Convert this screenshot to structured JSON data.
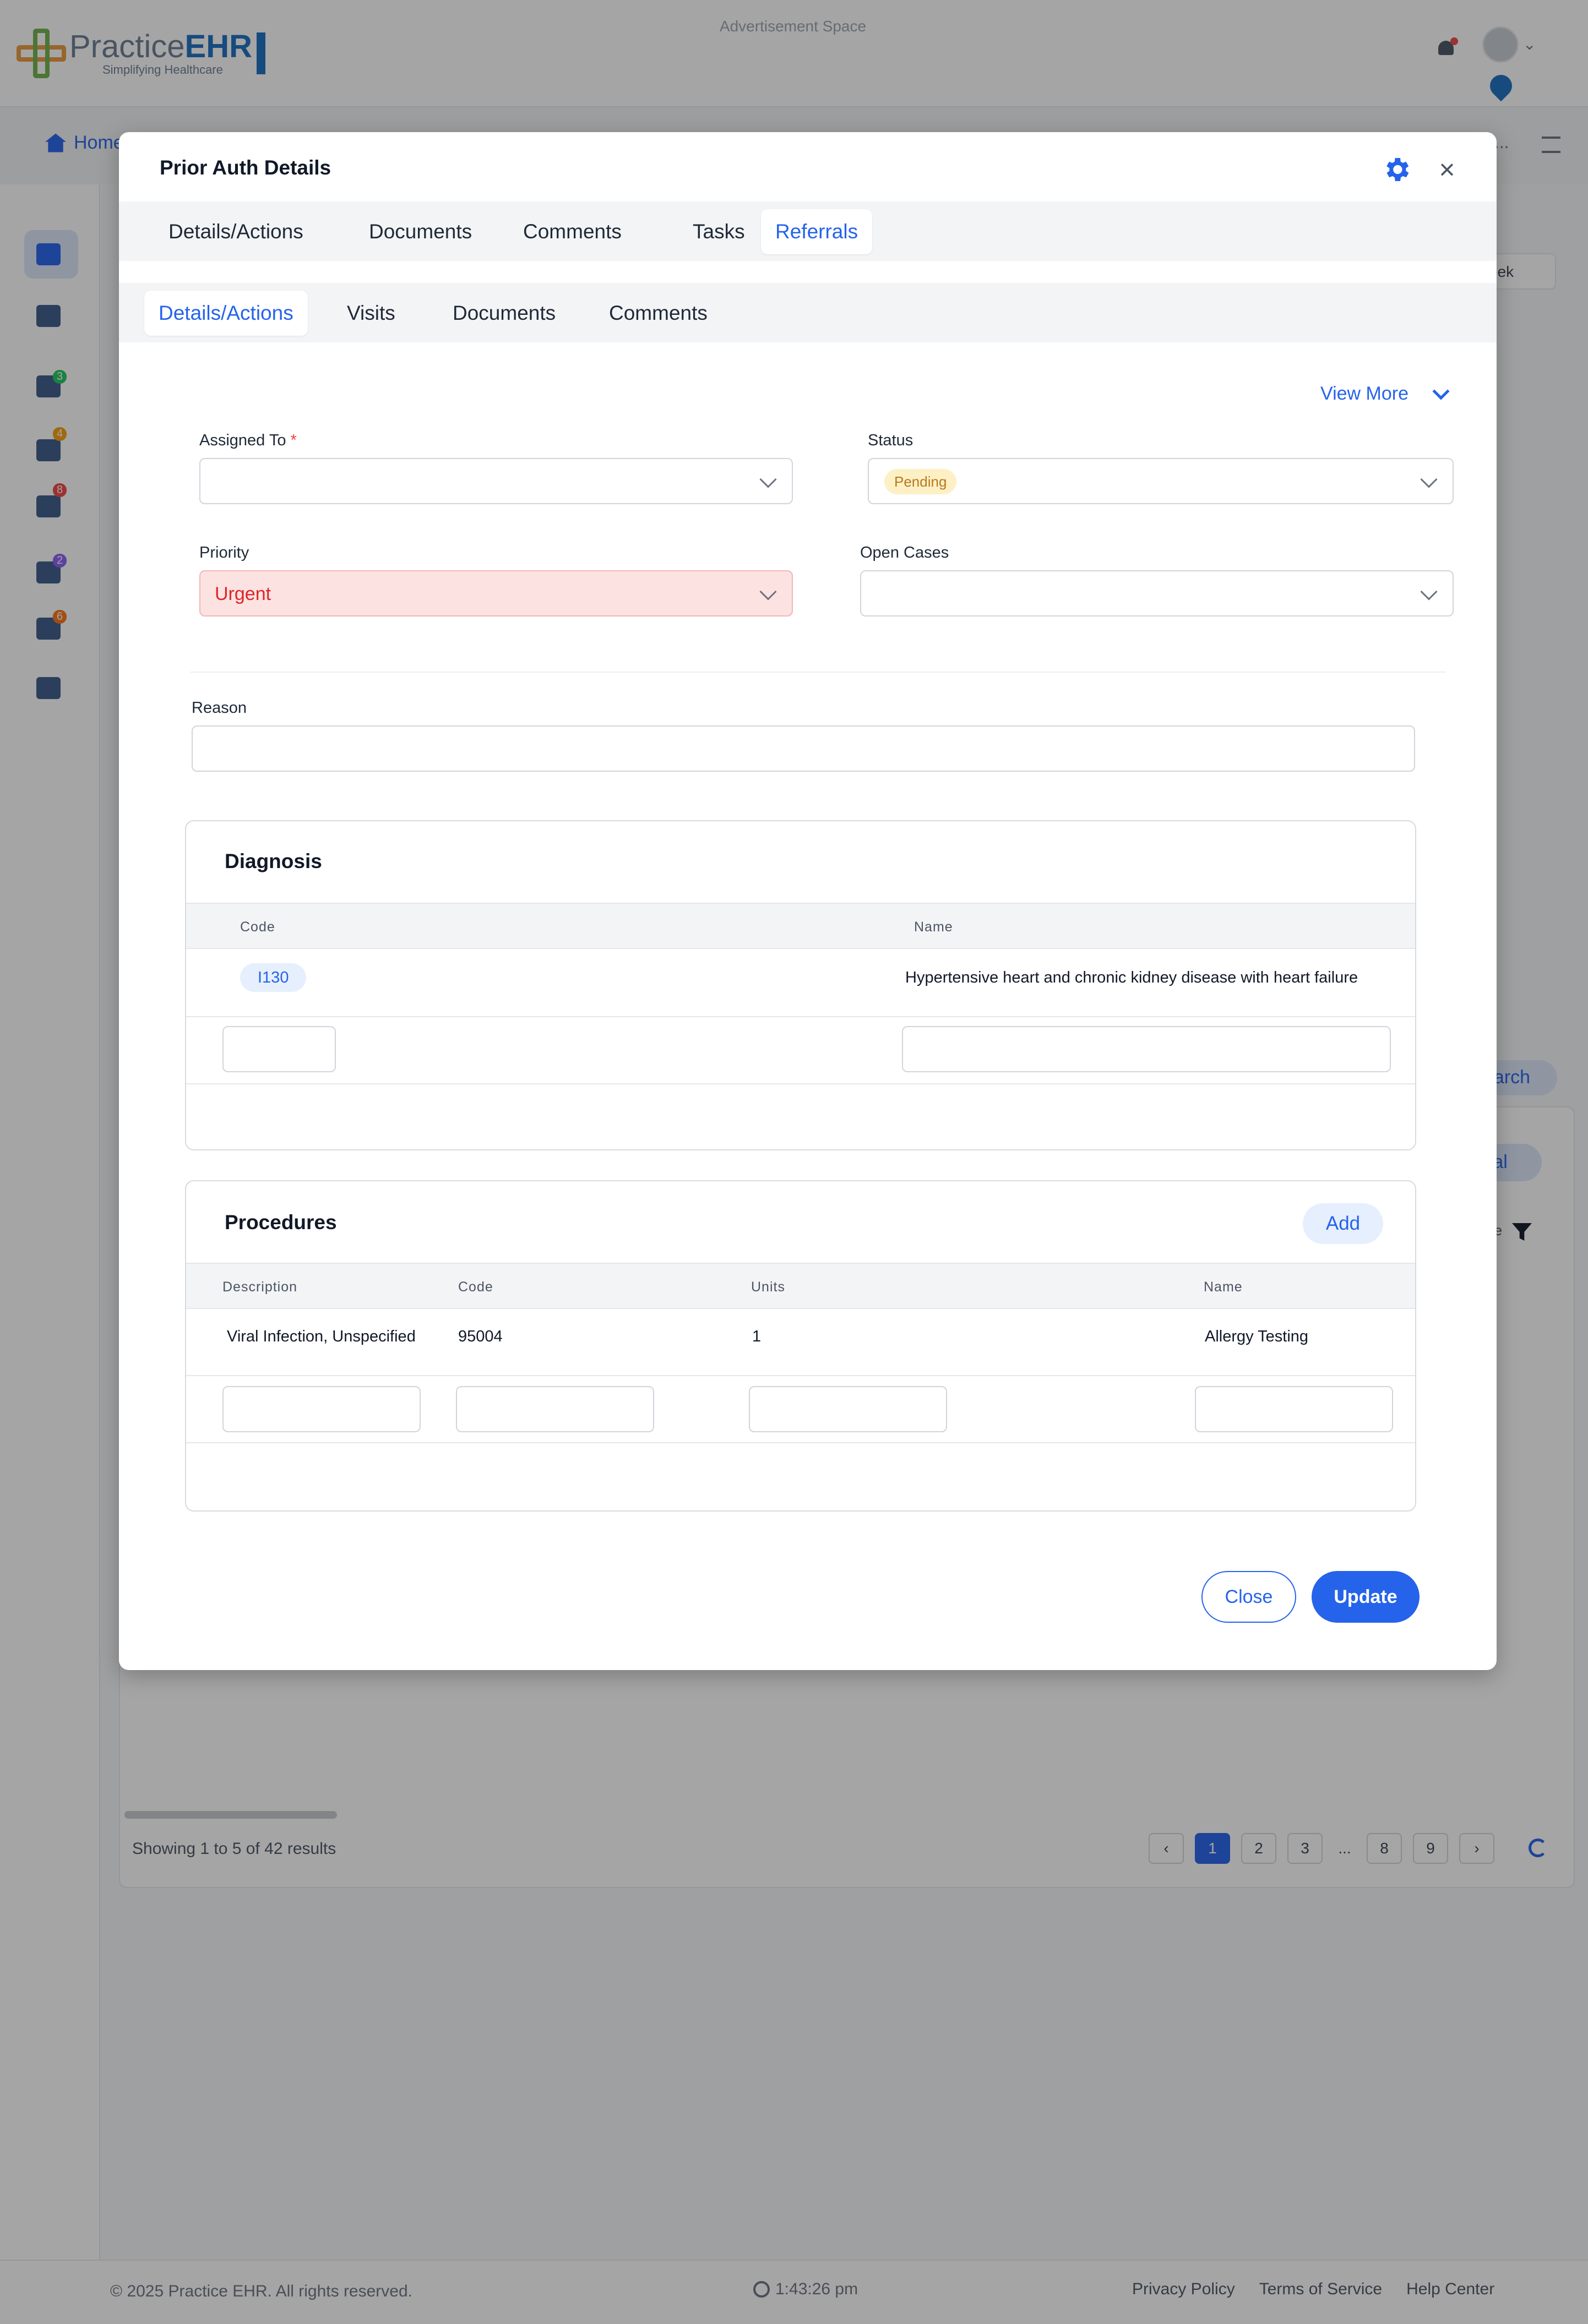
{
  "header": {
    "logo": {
      "main": "Practice",
      "main_bold": "EHR",
      "tagline": "Simplifying Healthcare"
    },
    "ad_space": "Advertisement Space"
  },
  "breadcrumb": {
    "home": "Home",
    "right_text": "n..."
  },
  "background": {
    "week_select": "eek",
    "search_button": "earch",
    "referral_button": "ral",
    "date_header": "ate",
    "sidebar_badges": [
      "3",
      "4",
      "8",
      "2",
      "6"
    ],
    "showing": "Showing 1 to 5 of 42 results",
    "pages": [
      "1",
      "2",
      "3",
      "...",
      "8",
      "9"
    ]
  },
  "modal": {
    "title": "Prior Auth Details",
    "top_tabs": [
      "Details/Actions",
      "Documents",
      "Comments",
      "Tasks",
      "Referrals"
    ],
    "top_tabs_active": "Referrals",
    "sub_tabs": [
      "Details/Actions",
      "Visits",
      "Documents",
      "Comments"
    ],
    "sub_tabs_active": "Details/Actions",
    "view_more": "View More",
    "form": {
      "assigned_to_label": "Assigned To",
      "required_mark": "*",
      "assigned_to_value": "",
      "status_label": "Status",
      "status_value": "Pending",
      "priority_label": "Priority",
      "priority_value": "Urgent",
      "open_cases_label": "Open Cases",
      "open_cases_value": "",
      "reason_label": "Reason",
      "reason_value": ""
    },
    "diagnosis": {
      "title": "Diagnosis",
      "columns": [
        "Code",
        "Name"
      ],
      "rows": [
        {
          "code": "I130",
          "name": "Hypertensive heart and chronic kidney disease with heart failure"
        }
      ]
    },
    "procedures": {
      "title": "Procedures",
      "add_label": "Add",
      "columns": [
        "Description",
        "Code",
        "Units",
        "Name"
      ],
      "rows": [
        {
          "description": "Viral Infection, Unspecified",
          "code": "95004",
          "units": "1",
          "name": "Allergy Testing"
        }
      ]
    },
    "buttons": {
      "close": "Close",
      "update": "Update"
    }
  },
  "footer": {
    "copyright": "© 2025 Practice EHR. All rights reserved.",
    "time": "1:43:26 pm",
    "links": [
      "Privacy Policy",
      "Terms of Service",
      "Help Center"
    ]
  },
  "colors": {
    "accent": "#2563eb",
    "urgent_bg": "#fde2e2",
    "urgent_text": "#dc2626",
    "pending_bg": "#fdf0c4",
    "pending_text": "#b7791f"
  }
}
